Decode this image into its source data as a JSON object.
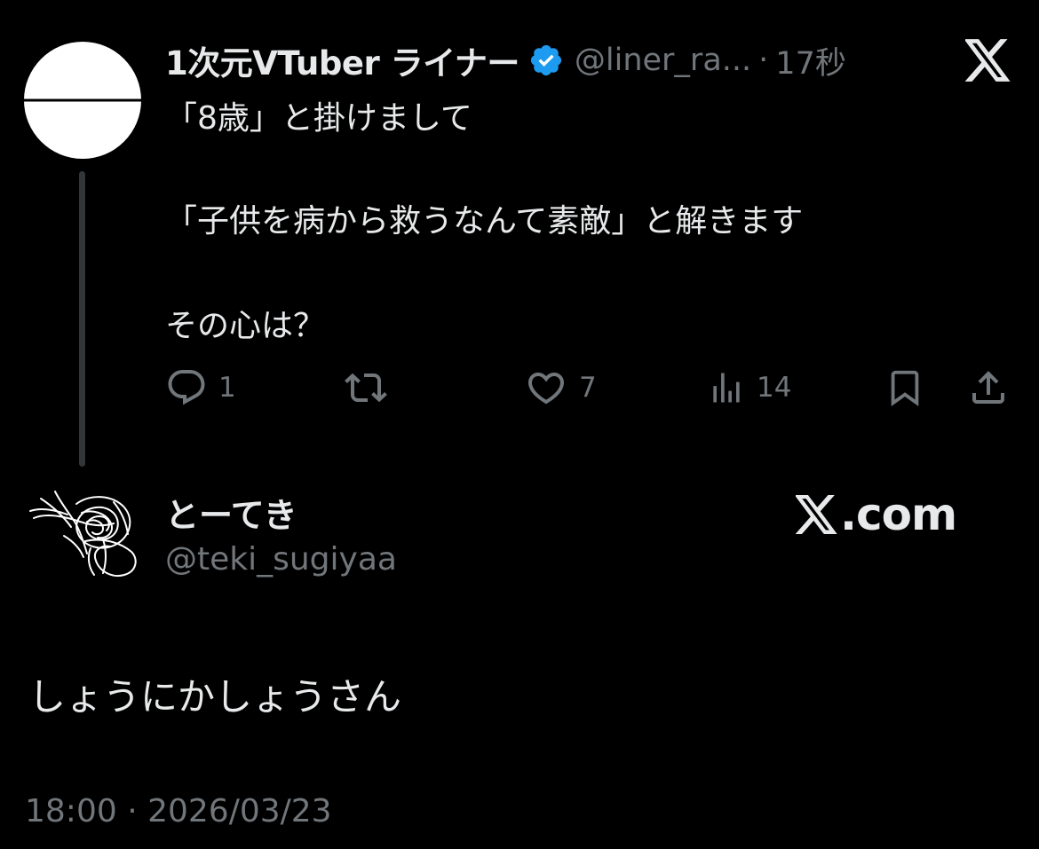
{
  "colors": {
    "background": "#000000",
    "text_primary": "#e7e9ea",
    "text_secondary": "#71767b",
    "verified_blue": "#1d9bf0",
    "thread_line": "#333639"
  },
  "parent_tweet": {
    "display_name": "1次元VTuber ライナー",
    "verified_icon": "verified-badge-icon",
    "handle": "@liner_ra...",
    "separator": "·",
    "time_ago": "17秒",
    "text_lines": [
      "「8歳」と掛けまして",
      "「子供を病から救うなんて素敵」と解きます",
      "その心は？"
    ],
    "actions": {
      "reply": {
        "icon": "reply-icon",
        "count": "1"
      },
      "retweet": {
        "icon": "retweet-icon",
        "count": ""
      },
      "like": {
        "icon": "heart-icon",
        "count": "7"
      },
      "views": {
        "icon": "views-icon",
        "count": "14"
      },
      "bookmark": {
        "icon": "bookmark-icon"
      },
      "share": {
        "icon": "share-icon"
      }
    }
  },
  "reply_tweet": {
    "display_name": "とーてき",
    "handle": "@teki_sugiyaa",
    "text": "しょうにかしょうさん",
    "timestamp": "18:00 · 2026/03/23"
  },
  "branding": {
    "x_logo_icon": "x-logo-icon",
    "site": ".com"
  }
}
